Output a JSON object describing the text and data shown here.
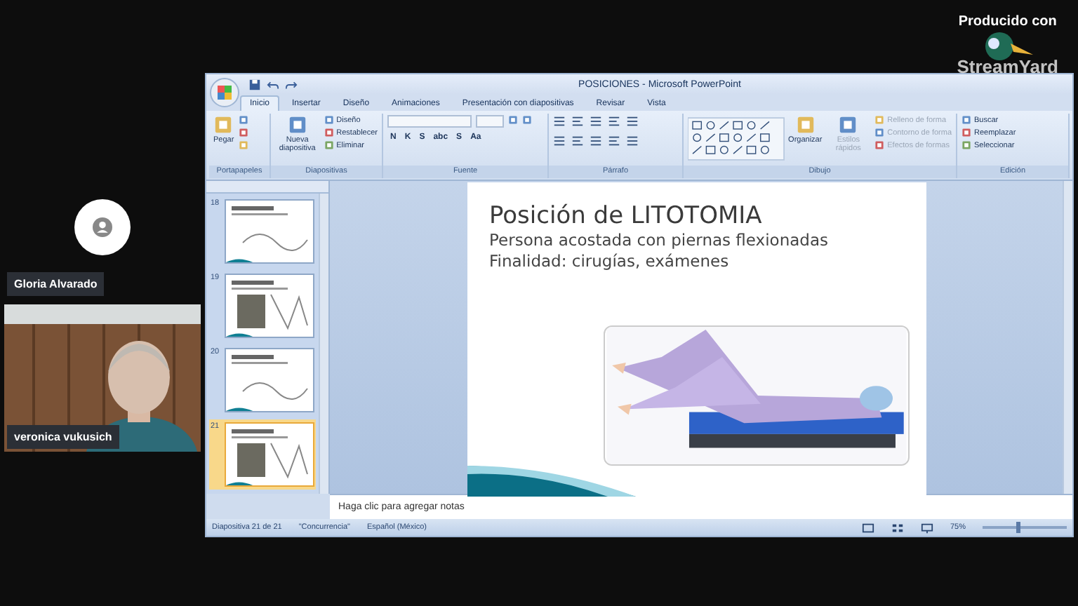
{
  "branding": {
    "caption": "Producido con",
    "logo_text": "StreamYard"
  },
  "participants": [
    {
      "name": "Gloria Alvarado",
      "kind": "avatar"
    },
    {
      "name": "veronica vukusich",
      "kind": "video"
    }
  ],
  "window": {
    "title": "POSICIONES - Microsoft PowerPoint"
  },
  "tabs": [
    {
      "label": "Inicio",
      "selected": true
    },
    {
      "label": "Insertar",
      "selected": false
    },
    {
      "label": "Diseño",
      "selected": false
    },
    {
      "label": "Animaciones",
      "selected": false
    },
    {
      "label": "Presentación con diapositivas",
      "selected": false
    },
    {
      "label": "Revisar",
      "selected": false
    },
    {
      "label": "Vista",
      "selected": false
    }
  ],
  "groups": [
    {
      "label": "Portapapeles",
      "kind": "clipboard",
      "large_buttons": [
        {
          "label": "Pegar",
          "disabled": false
        }
      ]
    },
    {
      "label": "Diapositivas",
      "kind": "slides",
      "large_buttons": [
        {
          "label": "Nueva diapositiva",
          "disabled": false
        }
      ],
      "small_buttons": [
        {
          "label": "Diseño",
          "disabled": false
        },
        {
          "label": "Restablecer",
          "disabled": false
        },
        {
          "label": "Eliminar",
          "disabled": false
        }
      ]
    },
    {
      "label": "Fuente",
      "kind": "font",
      "glyphs": [
        "N",
        "K",
        "S",
        "abc",
        "S",
        "Aa"
      ]
    },
    {
      "label": "Párrafo",
      "kind": "paragraph"
    },
    {
      "label": "Dibujo",
      "kind": "drawing",
      "large_buttons": [
        {
          "label": "Organizar",
          "disabled": false
        },
        {
          "label": "Estilos rápidos",
          "disabled": true
        }
      ],
      "small_buttons": [
        {
          "label": "Relleno de forma",
          "disabled": true
        },
        {
          "label": "Contorno de forma",
          "disabled": true
        },
        {
          "label": "Efectos de formas",
          "disabled": true
        }
      ]
    },
    {
      "label": "Edición",
      "kind": "editing",
      "small_buttons": [
        {
          "label": "Buscar",
          "disabled": false
        },
        {
          "label": "Reemplazar",
          "disabled": false
        },
        {
          "label": "Seleccionar",
          "disabled": false
        }
      ]
    }
  ],
  "thumbnails": [
    {
      "number": "18",
      "selected": false
    },
    {
      "number": "19",
      "selected": false
    },
    {
      "number": "20",
      "selected": false
    },
    {
      "number": "21",
      "selected": true
    }
  ],
  "slide": {
    "title": "Posición de LITOTOMIA",
    "lines": [
      "Persona acostada con piernas flexionadas",
      "Finalidad: cirugías, exámenes"
    ]
  },
  "notes": {
    "placeholder": "Haga clic para agregar notas"
  },
  "status_bar": {
    "items": [
      "Diapositiva 21 de 21",
      "\"Concurrencia\"",
      "Español (México)"
    ],
    "zoom": "75%",
    "level": 0.4
  }
}
